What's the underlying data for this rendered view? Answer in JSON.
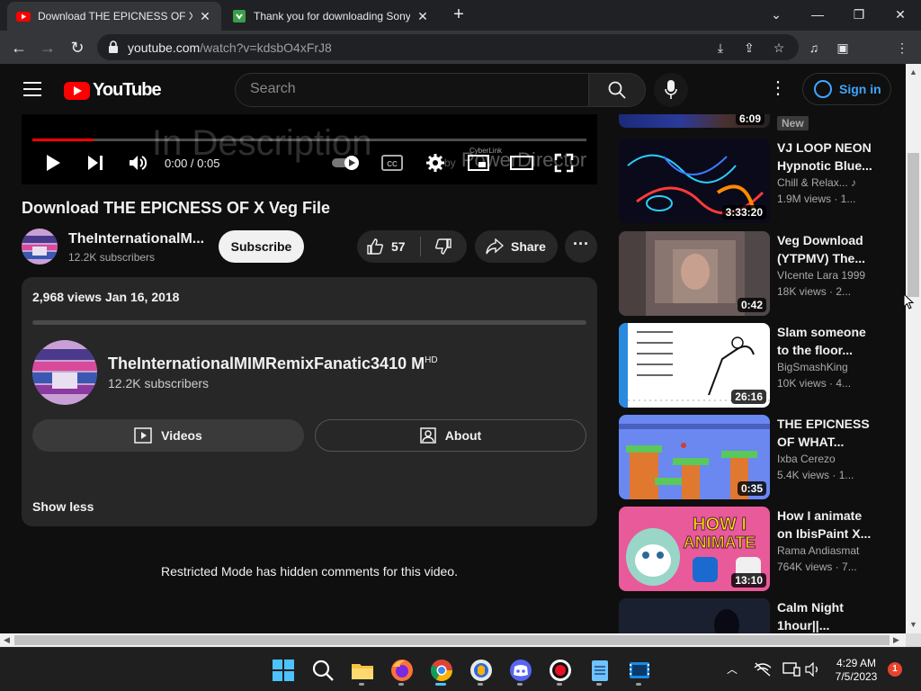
{
  "browser": {
    "tabs": [
      {
        "title": "Download THE EPICNESS OF X Ve",
        "icon": "youtube-icon",
        "active": true
      },
      {
        "title": "Thank you for downloading Sony",
        "icon": "download-site-icon",
        "active": false
      }
    ],
    "url_host": "youtube.com",
    "url_path": "/watch?v=kdsbO4xFrJ8"
  },
  "header": {
    "logo_text": "YouTube",
    "search_placeholder": "Search",
    "signin_label": "Sign in"
  },
  "player": {
    "time": "0:00 / 0:05",
    "progress": 0.11,
    "watermark_text": "In Description",
    "watermark_brand": "PowerDirector",
    "watermark_by": "by",
    "watermark_small": "CyberLink"
  },
  "video": {
    "title": "Download THE EPICNESS OF X Veg File",
    "channel_name": "TheInternationalM...",
    "channel_subs": "12.2K subscribers",
    "subscribe_label": "Subscribe",
    "likes": "57",
    "share_label": "Share"
  },
  "description": {
    "meta": "2,968 views  Jan 16, 2018",
    "channel_name": "TheInternationalMIMRemixFanatic3410 M",
    "channel_hd": "HD",
    "channel_subs": "12.2K subscribers",
    "videos_label": "Videos",
    "about_label": "About",
    "show_less": "Show less"
  },
  "comments": {
    "restricted_text": "Restricted Mode has hidden comments for this video."
  },
  "sidebar": {
    "top_duration": "6:09",
    "new_badge": "New",
    "recs": [
      {
        "title_line1": "VJ LOOP NEON",
        "title_line2": "Hypnotic Blue...",
        "channel": "Chill & Relax...",
        "views": "1.9M views · 1...",
        "duration": "3:33:20"
      },
      {
        "title_line1": "Veg Download",
        "title_line2": "(YTPMV) The...",
        "channel": "VIcente Lara 1999",
        "views": "18K views · 2...",
        "duration": "0:42"
      },
      {
        "title_line1": "Slam someone",
        "title_line2": "to the floor...",
        "channel": "BigSmashKing",
        "views": "10K views · 4...",
        "duration": "26:16"
      },
      {
        "title_line1": "THE EPICNESS",
        "title_line2": "OF WHAT...",
        "channel": "Ixba Cerezo",
        "views": "5.4K views · 1...",
        "duration": "0:35"
      },
      {
        "title_line1": "How I animate",
        "title_line2": "on IbisPaint X...",
        "channel": "Rama Andiasmat",
        "views": "764K views · 7...",
        "duration": "13:10"
      },
      {
        "title_line1": "Calm Night",
        "title_line2": "1hour||...",
        "channel": "",
        "views": "",
        "duration": ""
      }
    ]
  },
  "taskbar": {
    "time": "4:29 AM",
    "date": "7/5/2023",
    "notification_count": "1"
  },
  "colors": {
    "yt_red": "#ff0000",
    "link_blue": "#3ea6ff",
    "bg": "#0f0f0f"
  }
}
